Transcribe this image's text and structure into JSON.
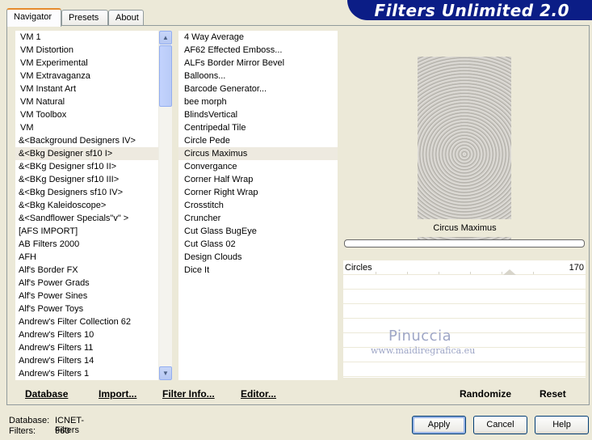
{
  "banner": {
    "title": "Filters Unlimited 2.0"
  },
  "tabs": [
    "Navigator",
    "Presets",
    "About"
  ],
  "categories": [
    "VM 1",
    "VM Distortion",
    "VM Experimental",
    "VM Extravaganza",
    "VM Instant Art",
    "VM Natural",
    "VM Toolbox",
    "VM",
    "&<Background Designers IV>",
    "&<Bkg Designer sf10 I>",
    "&<BKg Designer sf10 II>",
    "&<BKg Designer sf10 III>",
    "&<Bkg Designers sf10 IV>",
    "&<Bkg Kaleidoscope>",
    "&<Sandflower Specials\"v\" >",
    "[AFS IMPORT]",
    "AB Filters 2000",
    "AFH",
    "Alf's Border FX",
    "Alf's Power Grads",
    "Alf's Power Sines",
    "Alf's Power Toys",
    "Andrew's Filter Collection 62",
    "Andrew's Filters 10",
    "Andrew's Filters 11",
    "Andrew's Filters 14",
    "Andrew's Filters 1"
  ],
  "selected_category": "&<Bkg Designer sf10 I>",
  "filters": [
    "4 Way Average",
    "AF62 Effected Emboss...",
    "ALFs Border Mirror Bevel",
    "Balloons...",
    "Barcode Generator...",
    "bee morph",
    "BlindsVertical",
    "Centripedal Tile",
    "Circle Pede",
    "Circus Maximus",
    "Convergance",
    "Corner Half Wrap",
    "Corner Right Wrap",
    "Crosstitch",
    "Cruncher",
    "Cut Glass  BugEye",
    "Cut Glass 02",
    "Design Clouds",
    "Dice It"
  ],
  "selected_filter": "Circus Maximus",
  "preview": {
    "caption": "Circus Maximus"
  },
  "params": [
    {
      "label": "Circles",
      "value": "170"
    }
  ],
  "watermark": {
    "name": "Pinuccia",
    "url": "www.maidiregrafica.eu"
  },
  "bottom_buttons": {
    "database": "Database",
    "import": "Import...",
    "filter_info": "Filter Info...",
    "editor": "Editor...",
    "randomize": "Randomize",
    "reset": "Reset"
  },
  "status": {
    "database_label": "Database:",
    "database_value": "ICNET-Filters",
    "filters_label": "Filters:",
    "filters_value": "960"
  },
  "dialog": {
    "apply": "Apply",
    "cancel": "Cancel",
    "help": "Help"
  },
  "colors": {
    "banner": "#0b1d86",
    "selection": "#eeeae0",
    "tab_accent": "#e68b2c"
  }
}
